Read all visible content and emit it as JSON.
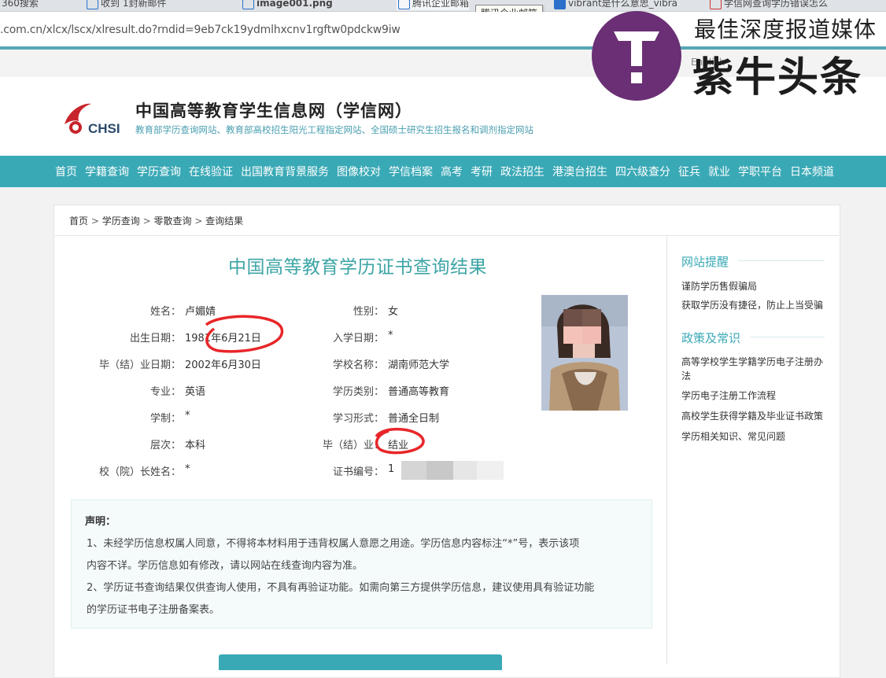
{
  "browser": {
    "tabs": [
      {
        "label": "360搜索"
      },
      {
        "label": "收到 1封新邮件"
      },
      {
        "label": "image001.png"
      },
      {
        "label": "腾讯企业邮箱"
      },
      {
        "label": "vibrant是什么意思_vibra"
      },
      {
        "label": "学信网查询学历错误怎么"
      }
    ],
    "tooltip": "腾讯企业邮箱",
    "url": ".com.cn/xlcx/lscx/xlresult.do?rndid=9eb7ck19ydmlhxcnv1rgftw0pdckw9iw",
    "lang": "English"
  },
  "site": {
    "logo_text": "CHSI",
    "title": "中国高等教育学生信息网（学信网）",
    "subtitle": "教育部学历查询网站、教育部高校招生阳光工程指定网站、全国硕士研究生招生报名和调剂指定网站",
    "nav": [
      "首页",
      "学籍查询",
      "学历查询",
      "在线验证",
      "出国教育背景服务",
      "图像校对",
      "学信档案",
      "高考",
      "考研",
      "政法招生",
      "港澳台招生",
      "四六级查分",
      "征兵",
      "就业",
      "学职平台",
      "日本频道"
    ]
  },
  "breadcrumb": [
    "首页",
    "学历查询",
    "零散查询",
    "查询结果"
  ],
  "result": {
    "title": "中国高等教育学历证书查询结果",
    "fields": [
      {
        "label": "姓名：",
        "value": "卢媚婧"
      },
      {
        "label": "性别：",
        "value": "女"
      },
      {
        "label": "出生日期：",
        "value": "1981年6月21日"
      },
      {
        "label": "入学日期：",
        "value": "*"
      },
      {
        "label": "毕（结）业日期：",
        "value": "2002年6月30日"
      },
      {
        "label": "学校名称：",
        "value": "湖南师范大学"
      },
      {
        "label": "专业：",
        "value": "英语"
      },
      {
        "label": "学历类别：",
        "value": "普通高等教育"
      },
      {
        "label": "学制：",
        "value": "*"
      },
      {
        "label": "学习形式：",
        "value": "普通全日制"
      },
      {
        "label": "层次：",
        "value": "本科"
      },
      {
        "label": "毕（结）业：",
        "value": "结业"
      },
      {
        "label": "校（院）长姓名：",
        "value": "*"
      },
      {
        "label": "证书编号：",
        "value": "1"
      }
    ]
  },
  "declaration": {
    "title": "声明：",
    "lines": [
      "1、未经学历信息权属人同意，不得将本材料用于违背权属人意愿之用途。学历信息内容标注“*”号，表示该项",
      "内容不详。学历信息如有修改，请以网站在线查询内容为准。",
      "2、学历证书查询结果仅供查询人使用，不具有再验证功能。如需向第三方提供学历信息，建议使用具有验证功能",
      "的学历证书电子注册备案表。"
    ]
  },
  "sidebar": {
    "section1": {
      "title": "网站提醒",
      "links": [
        "谨防学历售假骗局",
        "获取学历没有捷径，防止上当受骗"
      ]
    },
    "section2": {
      "title": "政策及常识",
      "links": [
        "高等学校学生学籍学历电子注册办",
        "法",
        "学历电子注册工作流程",
        "高校学生获得学籍及毕业证书政策",
        "学历相关知识、常见问题"
      ]
    }
  },
  "watermark": {
    "top": "最佳深度报道媒体",
    "main": "紫牛头条"
  },
  "colors": {
    "accent": "#3aa9b6",
    "title_teal": "#3ea5a6",
    "watermark_purple": "#6a2f74",
    "annotation_red": "#e8262a"
  }
}
